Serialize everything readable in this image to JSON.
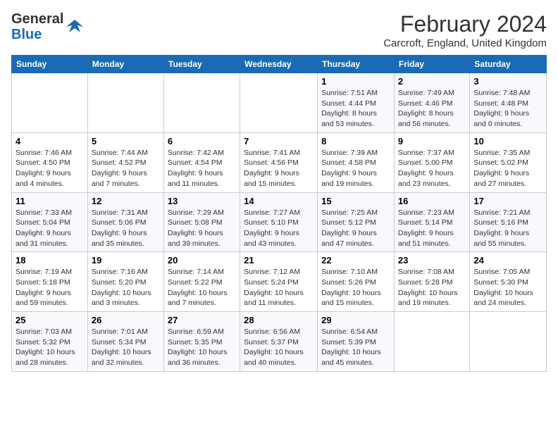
{
  "logo": {
    "line1": "General",
    "line2": "Blue"
  },
  "title": "February 2024",
  "location": "Carcroft, England, United Kingdom",
  "days_of_week": [
    "Sunday",
    "Monday",
    "Tuesday",
    "Wednesday",
    "Thursday",
    "Friday",
    "Saturday"
  ],
  "weeks": [
    [
      {
        "day": "",
        "info": ""
      },
      {
        "day": "",
        "info": ""
      },
      {
        "day": "",
        "info": ""
      },
      {
        "day": "",
        "info": ""
      },
      {
        "day": "1",
        "info": "Sunrise: 7:51 AM\nSunset: 4:44 PM\nDaylight: 8 hours\nand 53 minutes."
      },
      {
        "day": "2",
        "info": "Sunrise: 7:49 AM\nSunset: 4:46 PM\nDaylight: 8 hours\nand 56 minutes."
      },
      {
        "day": "3",
        "info": "Sunrise: 7:48 AM\nSunset: 4:48 PM\nDaylight: 9 hours\nand 0 minutes."
      }
    ],
    [
      {
        "day": "4",
        "info": "Sunrise: 7:46 AM\nSunset: 4:50 PM\nDaylight: 9 hours\nand 4 minutes."
      },
      {
        "day": "5",
        "info": "Sunrise: 7:44 AM\nSunset: 4:52 PM\nDaylight: 9 hours\nand 7 minutes."
      },
      {
        "day": "6",
        "info": "Sunrise: 7:42 AM\nSunset: 4:54 PM\nDaylight: 9 hours\nand 11 minutes."
      },
      {
        "day": "7",
        "info": "Sunrise: 7:41 AM\nSunset: 4:56 PM\nDaylight: 9 hours\nand 15 minutes."
      },
      {
        "day": "8",
        "info": "Sunrise: 7:39 AM\nSunset: 4:58 PM\nDaylight: 9 hours\nand 19 minutes."
      },
      {
        "day": "9",
        "info": "Sunrise: 7:37 AM\nSunset: 5:00 PM\nDaylight: 9 hours\nand 23 minutes."
      },
      {
        "day": "10",
        "info": "Sunrise: 7:35 AM\nSunset: 5:02 PM\nDaylight: 9 hours\nand 27 minutes."
      }
    ],
    [
      {
        "day": "11",
        "info": "Sunrise: 7:33 AM\nSunset: 5:04 PM\nDaylight: 9 hours\nand 31 minutes."
      },
      {
        "day": "12",
        "info": "Sunrise: 7:31 AM\nSunset: 5:06 PM\nDaylight: 9 hours\nand 35 minutes."
      },
      {
        "day": "13",
        "info": "Sunrise: 7:29 AM\nSunset: 5:08 PM\nDaylight: 9 hours\nand 39 minutes."
      },
      {
        "day": "14",
        "info": "Sunrise: 7:27 AM\nSunset: 5:10 PM\nDaylight: 9 hours\nand 43 minutes."
      },
      {
        "day": "15",
        "info": "Sunrise: 7:25 AM\nSunset: 5:12 PM\nDaylight: 9 hours\nand 47 minutes."
      },
      {
        "day": "16",
        "info": "Sunrise: 7:23 AM\nSunset: 5:14 PM\nDaylight: 9 hours\nand 51 minutes."
      },
      {
        "day": "17",
        "info": "Sunrise: 7:21 AM\nSunset: 5:16 PM\nDaylight: 9 hours\nand 55 minutes."
      }
    ],
    [
      {
        "day": "18",
        "info": "Sunrise: 7:19 AM\nSunset: 5:18 PM\nDaylight: 9 hours\nand 59 minutes."
      },
      {
        "day": "19",
        "info": "Sunrise: 7:16 AM\nSunset: 5:20 PM\nDaylight: 10 hours\nand 3 minutes."
      },
      {
        "day": "20",
        "info": "Sunrise: 7:14 AM\nSunset: 5:22 PM\nDaylight: 10 hours\nand 7 minutes."
      },
      {
        "day": "21",
        "info": "Sunrise: 7:12 AM\nSunset: 5:24 PM\nDaylight: 10 hours\nand 11 minutes."
      },
      {
        "day": "22",
        "info": "Sunrise: 7:10 AM\nSunset: 5:26 PM\nDaylight: 10 hours\nand 15 minutes."
      },
      {
        "day": "23",
        "info": "Sunrise: 7:08 AM\nSunset: 5:28 PM\nDaylight: 10 hours\nand 19 minutes."
      },
      {
        "day": "24",
        "info": "Sunrise: 7:05 AM\nSunset: 5:30 PM\nDaylight: 10 hours\nand 24 minutes."
      }
    ],
    [
      {
        "day": "25",
        "info": "Sunrise: 7:03 AM\nSunset: 5:32 PM\nDaylight: 10 hours\nand 28 minutes."
      },
      {
        "day": "26",
        "info": "Sunrise: 7:01 AM\nSunset: 5:34 PM\nDaylight: 10 hours\nand 32 minutes."
      },
      {
        "day": "27",
        "info": "Sunrise: 6:59 AM\nSunset: 5:35 PM\nDaylight: 10 hours\nand 36 minutes."
      },
      {
        "day": "28",
        "info": "Sunrise: 6:56 AM\nSunset: 5:37 PM\nDaylight: 10 hours\nand 40 minutes."
      },
      {
        "day": "29",
        "info": "Sunrise: 6:54 AM\nSunset: 5:39 PM\nDaylight: 10 hours\nand 45 minutes."
      },
      {
        "day": "",
        "info": ""
      },
      {
        "day": "",
        "info": ""
      }
    ]
  ]
}
